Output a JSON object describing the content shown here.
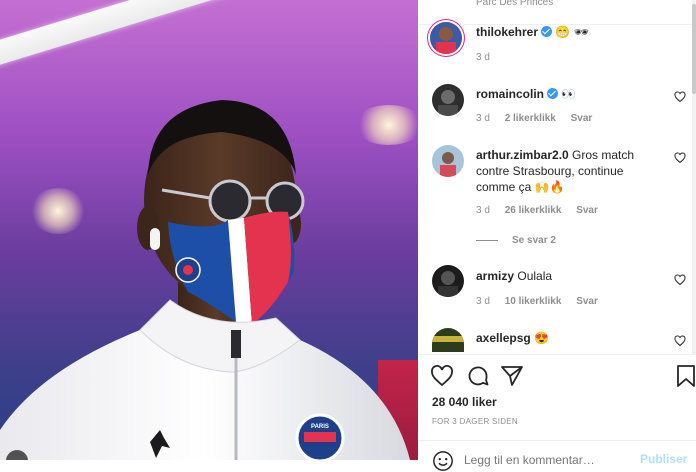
{
  "post": {
    "location": "Parc Des Princes",
    "likes_text": "28 040 liker",
    "posted_text": "FOR 3 DAGER SIDEN"
  },
  "comments": [
    {
      "username": "thilokehrer",
      "verified": true,
      "text": "😁 🕶",
      "time": "3 d"
    },
    {
      "username": "romaincolin",
      "verified": true,
      "text": "👀",
      "time": "3 d",
      "likes": "2 likerklikk",
      "reply": "Svar"
    },
    {
      "username": "arthur.zimbar2.0",
      "verified": false,
      "text": "Gros match contre Strasbourg, continue comme ça 🙌🔥",
      "time": "3 d",
      "likes": "26 likerklikk",
      "reply": "Svar"
    },
    {
      "username": "armizy",
      "verified": false,
      "text": "Oulala",
      "time": "3 d",
      "likes": "10 likerklikk",
      "reply": "Svar"
    },
    {
      "username": "axellepsg",
      "verified": false,
      "text": "😍"
    }
  ],
  "view_replies": "Se svar 2",
  "comment_input": {
    "placeholder": "Legg til en kommentar…"
  },
  "post_button": "Publiser",
  "icons": {
    "like": "heart-icon",
    "comment": "comment-icon",
    "share": "share-icon",
    "save": "bookmark-icon",
    "emoji": "emoji-icon"
  },
  "colors": {
    "verified": "#3897f0",
    "psg_red": "#e3334e",
    "psg_blue": "#1e4fa8"
  }
}
